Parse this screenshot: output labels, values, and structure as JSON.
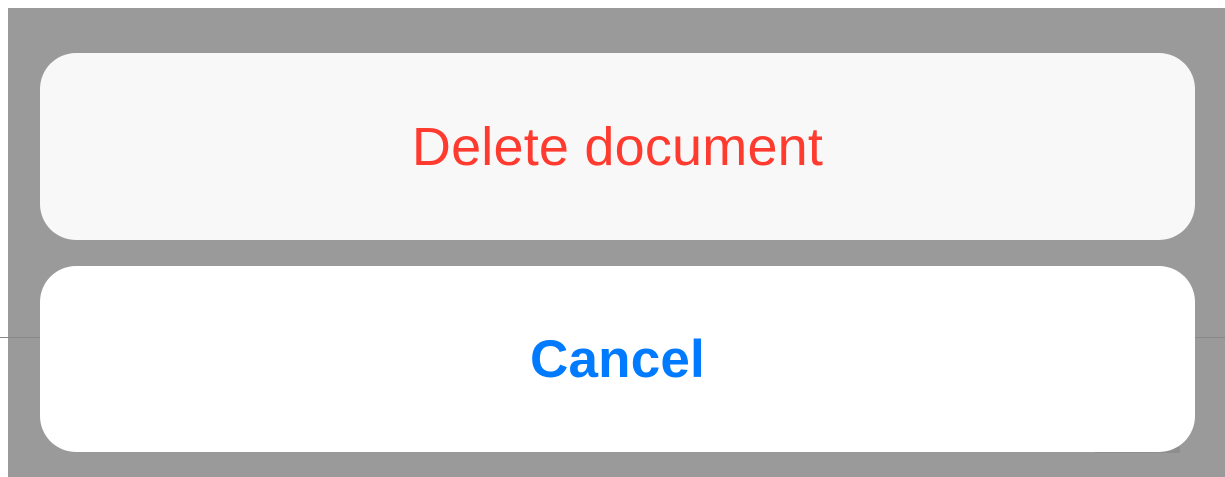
{
  "action_sheet": {
    "delete_label": "Delete document",
    "cancel_label": "Cancel"
  },
  "colors": {
    "destructive": "#ff3b30",
    "accent": "#007aff",
    "overlay": "#9a9a9a"
  }
}
